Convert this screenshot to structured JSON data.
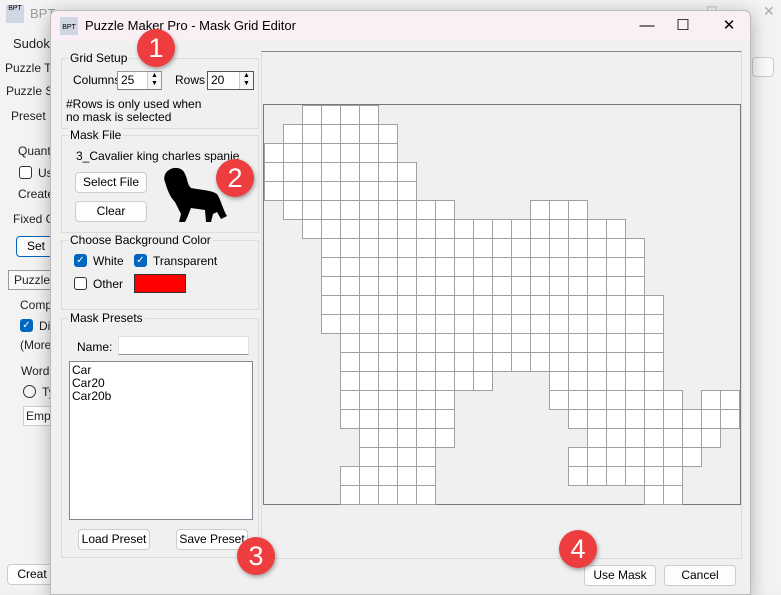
{
  "background_app": {
    "title": "BPT",
    "menu": "Sudoku",
    "labels": [
      "Puzzle Ty",
      "Puzzle Se",
      "Preset",
      "Quanti",
      "Us",
      "Create",
      "Fixed Gr",
      "Set",
      "Puzzle",
      "Compl",
      "Di",
      "(More",
      "Word",
      "Ty",
      "Empo",
      "Creat"
    ]
  },
  "dialog": {
    "title": "Puzzle Maker Pro - Mask Grid Editor",
    "controls": {
      "minimize": "—",
      "maximize": "☐",
      "close": "✕"
    }
  },
  "grid_setup": {
    "label": "Grid Setup",
    "columns_label": "Columns",
    "columns_value": "25",
    "rows_label": "Rows",
    "rows_value": "20",
    "note": "#Rows is only used when no mask is selected"
  },
  "mask_file": {
    "label": "Mask File",
    "file_name": "3_Cavalier king charles spanie",
    "select_button": "Select File",
    "clear_button": "Clear"
  },
  "background_color": {
    "label": "Choose Background Color",
    "white_label": "White",
    "white_checked": true,
    "transparent_label": "Transparent",
    "transparent_checked": true,
    "other_label": "Other",
    "other_checked": false,
    "other_color": "#ff0000"
  },
  "mask_presets": {
    "label": "Mask Presets",
    "name_label": "Name:",
    "name_value": "",
    "items": [
      "Car",
      "Car20",
      "Car20b"
    ],
    "load_button": "Load Preset",
    "save_button": "Save Preset"
  },
  "footer": {
    "use_mask_button": "Use Mask",
    "cancel_button": "Cancel"
  },
  "badges": [
    "1",
    "2",
    "3",
    "4"
  ],
  "badge_color": "#ee3d3f",
  "mask_grid": {
    "columns": 25,
    "rows": [
      "0011110000000000000000000",
      "0111111000000000000000000",
      "1111111000000000000000000",
      "1111111100000000000000000",
      "1111111100000000000000000",
      "0111111111000011100000000",
      "0011111111111111111000000",
      "0001111111111111111100000",
      "0001111111111111111100000",
      "0001111111111111111100000",
      "0001111111111111111110000",
      "0001111111111111111110000",
      "0000111111111111111110000",
      "0000111111111111111110000",
      "0000111111110001111110000",
      "0000111111000001111111011",
      "0000111111000000111111111",
      "0000011111000000011111110",
      "0000011110000000111111100",
      "0000111110000000111111000",
      "0000111110000000000011000"
    ]
  }
}
